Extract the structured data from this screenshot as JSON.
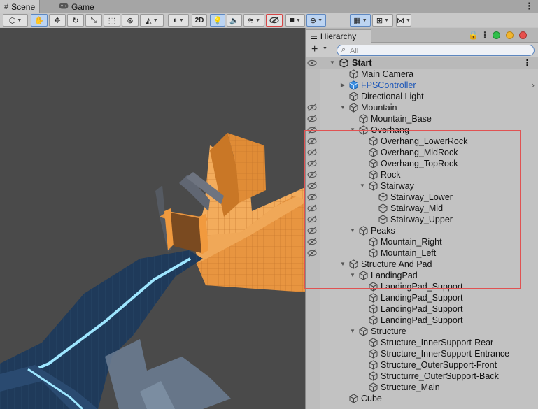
{
  "tabs": [
    {
      "label": "Scene",
      "icon": "grid-icon",
      "active": true
    },
    {
      "label": "Game",
      "icon": "gamepad-icon",
      "active": false
    }
  ],
  "toolbar": {
    "mode_2d": "2D"
  },
  "hierarchy": {
    "tab_label": "Hierarchy",
    "search_placeholder": "All",
    "scene_name": "Start",
    "items": [
      {
        "label": "Main Camera",
        "depth": 1,
        "fold": "none",
        "hidden": false,
        "prefab": false
      },
      {
        "label": "FPSController",
        "depth": 1,
        "fold": "collapsed",
        "hidden": false,
        "prefab": true
      },
      {
        "label": "Directional Light",
        "depth": 1,
        "fold": "none",
        "hidden": false,
        "prefab": false
      },
      {
        "label": "Mountain",
        "depth": 1,
        "fold": "expanded",
        "hidden": true,
        "prefab": false
      },
      {
        "label": "Mountain_Base",
        "depth": 2,
        "fold": "none",
        "hidden": true,
        "prefab": false
      },
      {
        "label": "Overhang",
        "depth": 2,
        "fold": "expanded",
        "hidden": true,
        "prefab": false
      },
      {
        "label": "Overhang_LowerRock",
        "depth": 3,
        "fold": "none",
        "hidden": true,
        "prefab": false
      },
      {
        "label": "Overhang_MidRock",
        "depth": 3,
        "fold": "none",
        "hidden": true,
        "prefab": false
      },
      {
        "label": "Overhang_TopRock",
        "depth": 3,
        "fold": "none",
        "hidden": true,
        "prefab": false
      },
      {
        "label": "Rock",
        "depth": 3,
        "fold": "none",
        "hidden": true,
        "prefab": false
      },
      {
        "label": "Stairway",
        "depth": 3,
        "fold": "expanded",
        "hidden": true,
        "prefab": false
      },
      {
        "label": "Stairway_Lower",
        "depth": 4,
        "fold": "none",
        "hidden": true,
        "prefab": false
      },
      {
        "label": "Stairway_Mid",
        "depth": 4,
        "fold": "none",
        "hidden": true,
        "prefab": false
      },
      {
        "label": "Stairway_Upper",
        "depth": 4,
        "fold": "none",
        "hidden": true,
        "prefab": false
      },
      {
        "label": "Peaks",
        "depth": 2,
        "fold": "expanded",
        "hidden": true,
        "prefab": false
      },
      {
        "label": "Mountain_Right",
        "depth": 3,
        "fold": "none",
        "hidden": true,
        "prefab": false
      },
      {
        "label": "Mountain_Left",
        "depth": 3,
        "fold": "none",
        "hidden": true,
        "prefab": false
      },
      {
        "label": "Structure And Pad",
        "depth": 1,
        "fold": "expanded",
        "hidden": false,
        "prefab": false
      },
      {
        "label": "LandingPad",
        "depth": 2,
        "fold": "expanded",
        "hidden": false,
        "prefab": false
      },
      {
        "label": "LandingPad_Support",
        "depth": 3,
        "fold": "none",
        "hidden": false,
        "prefab": false
      },
      {
        "label": "LandingPad_Support",
        "depth": 3,
        "fold": "none",
        "hidden": false,
        "prefab": false
      },
      {
        "label": "LandingPad_Support",
        "depth": 3,
        "fold": "none",
        "hidden": false,
        "prefab": false
      },
      {
        "label": "LandingPad_Support",
        "depth": 3,
        "fold": "none",
        "hidden": false,
        "prefab": false
      },
      {
        "label": "Structure",
        "depth": 2,
        "fold": "expanded",
        "hidden": false,
        "prefab": false
      },
      {
        "label": "Structure_InnerSupport-Rear",
        "depth": 3,
        "fold": "none",
        "hidden": false,
        "prefab": false
      },
      {
        "label": "Structure_InnerSupport-Entrance",
        "depth": 3,
        "fold": "none",
        "hidden": false,
        "prefab": false
      },
      {
        "label": "Structure_OuterSupport-Front",
        "depth": 3,
        "fold": "none",
        "hidden": false,
        "prefab": false
      },
      {
        "label": "Structurre_OuterSupport-Back",
        "depth": 3,
        "fold": "none",
        "hidden": false,
        "prefab": false
      },
      {
        "label": "Structure_Main",
        "depth": 3,
        "fold": "none",
        "hidden": false,
        "prefab": false
      },
      {
        "label": "Cube",
        "depth": 1,
        "fold": "none",
        "hidden": false,
        "prefab": false
      }
    ]
  },
  "colors": {
    "highlight": "#e05252",
    "prefab_text": "#1a55b8",
    "selected_tool": "#bcd4f2",
    "scene_orange": "#e89540",
    "scene_navy": "#1f3a5a"
  }
}
